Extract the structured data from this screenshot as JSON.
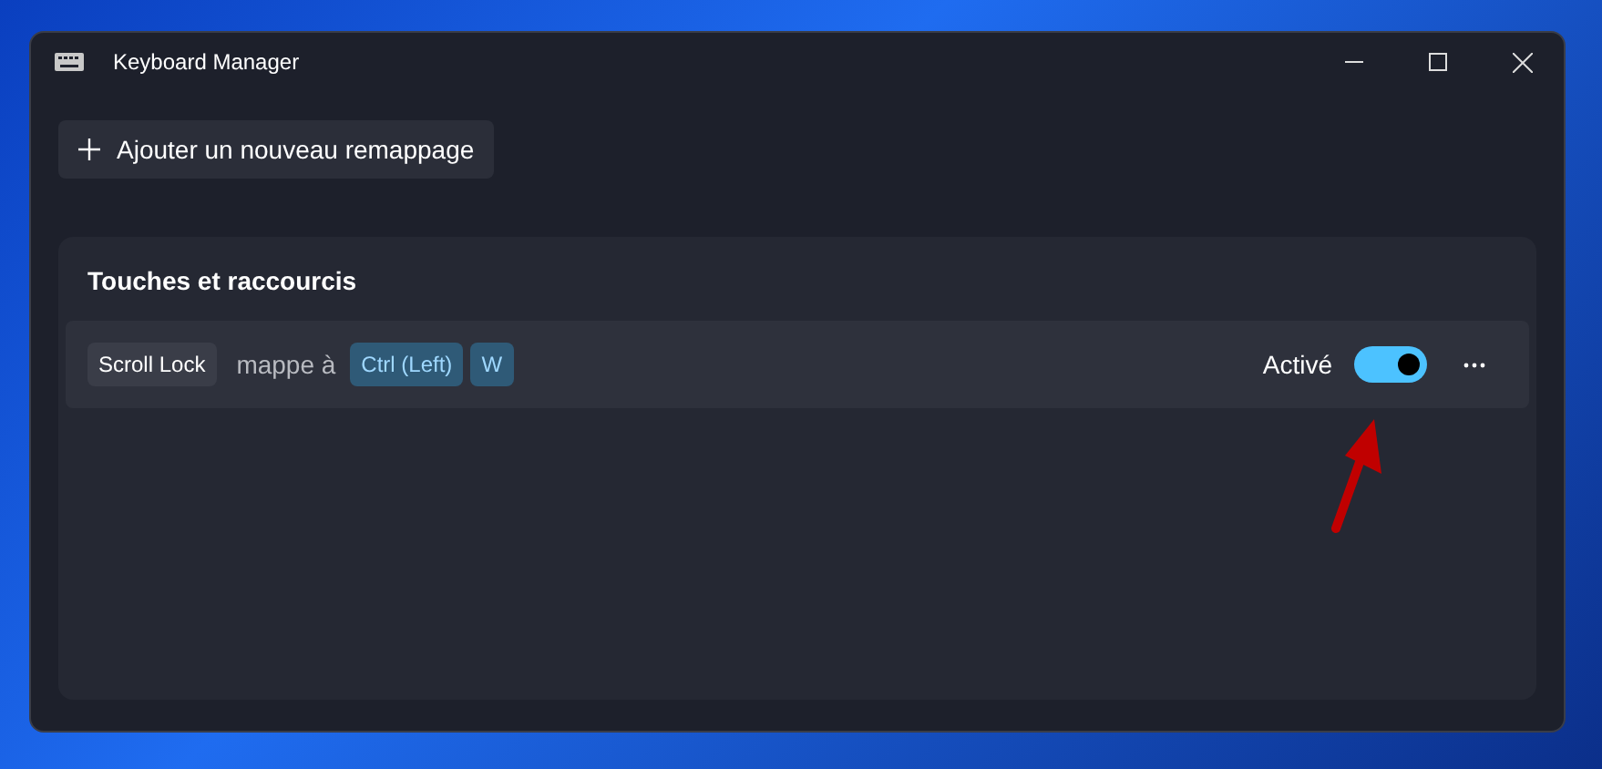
{
  "window": {
    "title": "Keyboard Manager"
  },
  "add_button": {
    "label": "Ajouter un nouveau remappage"
  },
  "section": {
    "title": "Touches et raccourcis",
    "mappings": [
      {
        "source_keys": [
          "Scroll Lock"
        ],
        "connector": "mappe à",
        "target_keys": [
          "Ctrl (Left)",
          "W"
        ],
        "toggle_label": "Activé",
        "on": true
      }
    ]
  }
}
